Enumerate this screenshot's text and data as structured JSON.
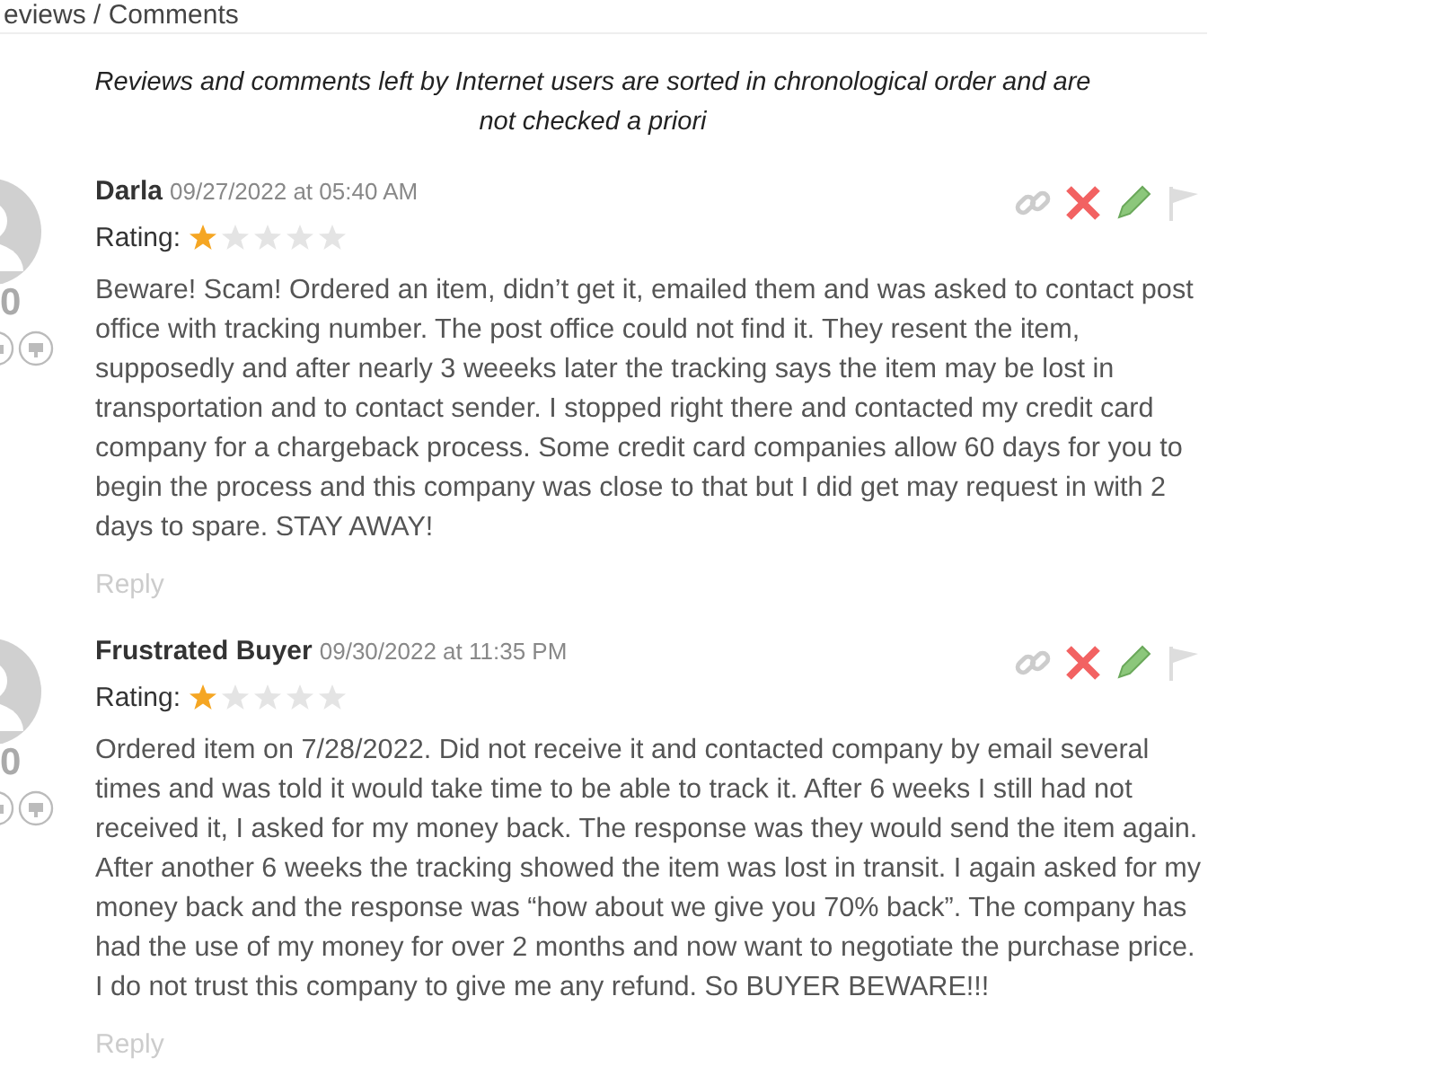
{
  "section_title": "eviews / Comments",
  "notice": "Reviews and comments left by Internet users are sorted in chronological order and are not checked a priori",
  "comments": [
    {
      "author": "Darla",
      "date": "09/27/2022 at 05:40 AM",
      "rating_label": "Rating:",
      "stars": 1,
      "votes": "0",
      "body": "Beware! Scam! Ordered an item, didn’t get it, emailed them and was asked to contact post office with tracking number. The post office could not find it. They resent the item, supposedly and after nearly 3 weeeks later the tracking says the item may be lost in transportation and to contact sender. I stopped right there and contacted my credit card company for a chargeback process. Some credit card companies allow 60 days for you to begin the process and this company was close to that but I did get may request in with 2 days to spare. STAY AWAY!",
      "reply": "Reply"
    },
    {
      "author": "Frustrated Buyer",
      "date": "09/30/2022 at 11:35 PM",
      "rating_label": "Rating:",
      "stars": 1,
      "votes": "0",
      "body": "Ordered item on 7/28/2022. Did not receive it and contacted company by email several times and was told it would take time to be able to track it. After 6 weeks I still had not received it, I asked for my money back. The response was they would send the item again. After another 6 weeks the tracking showed the item was lost in transit. I again asked for my money back and the response was “how about we give you 70% back”. The company has had the use of my money for over 2 months and now want to negotiate the purchase price. I do not trust this company to give me any refund. So BUYER BEWARE!!!",
      "reply": "Reply"
    }
  ]
}
